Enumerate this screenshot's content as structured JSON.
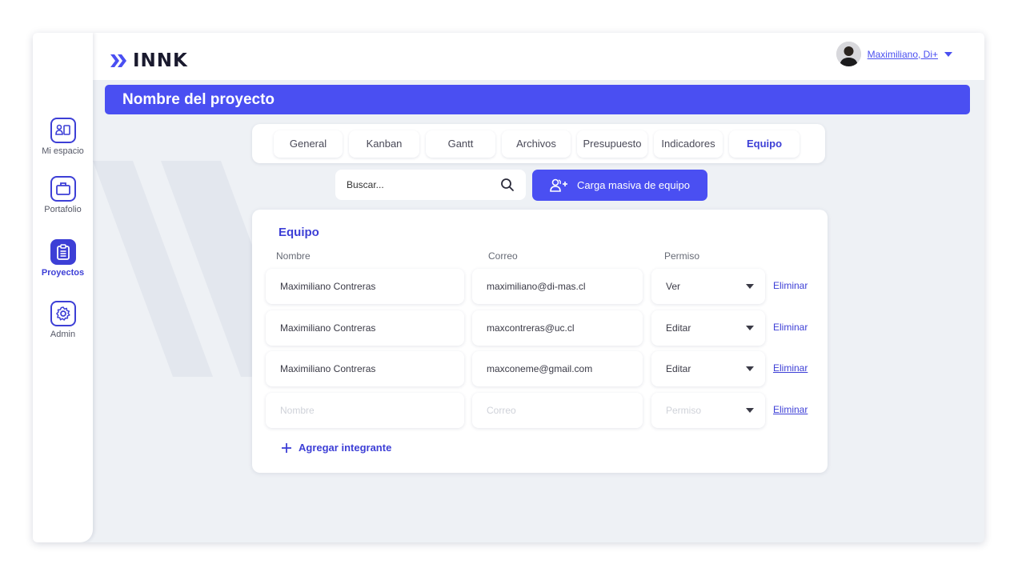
{
  "app": {
    "logo_text": "INNK"
  },
  "user": {
    "name": "Maximiliano, Di+"
  },
  "sidebar": {
    "items": [
      {
        "label": "Mi espacio",
        "icon": "workspace-icon",
        "active": false
      },
      {
        "label": "Portafolio",
        "icon": "briefcase-icon",
        "active": false
      },
      {
        "label": "Proyectos",
        "icon": "clipboard-icon",
        "active": true
      },
      {
        "label": "Admin",
        "icon": "gear-icon",
        "active": false
      }
    ]
  },
  "project": {
    "title": "Nombre del proyecto"
  },
  "tabs": [
    {
      "label": "General",
      "active": false
    },
    {
      "label": "Kanban",
      "active": false
    },
    {
      "label": "Gantt",
      "active": false
    },
    {
      "label": "Archivos",
      "active": false
    },
    {
      "label": "Presupuesto",
      "active": false
    },
    {
      "label": "Indicadores",
      "active": false
    },
    {
      "label": "Equipo",
      "active": true
    }
  ],
  "search": {
    "placeholder": "Buscar..."
  },
  "bulk_upload": {
    "label": "Carga masiva de equipo"
  },
  "team": {
    "title": "Equipo",
    "columns": {
      "name": "Nombre",
      "email": "Correo",
      "permission": "Permiso"
    },
    "rows": [
      {
        "name": "Maximiliano Contreras",
        "email": "maximiliano@di-mas.cl",
        "permission": "Ver",
        "remove": "Eliminar"
      },
      {
        "name": "Maximiliano Contreras",
        "email": "maxcontreras@uc.cl",
        "permission": "Editar",
        "remove": "Eliminar"
      },
      {
        "name": "Maximiliano Contreras",
        "email": "maxconeme@gmail.com",
        "permission": "Editar",
        "remove": "Eliminar"
      }
    ],
    "new_row": {
      "name_placeholder": "Nombre",
      "email_placeholder": "Correo",
      "permission_placeholder": "Permiso",
      "remove": "Eliminar"
    },
    "add_member": "Agregar integrante"
  },
  "colors": {
    "accent": "#4a4ff2",
    "accent_dark": "#3d3fd6",
    "background": "#eef1f5"
  }
}
